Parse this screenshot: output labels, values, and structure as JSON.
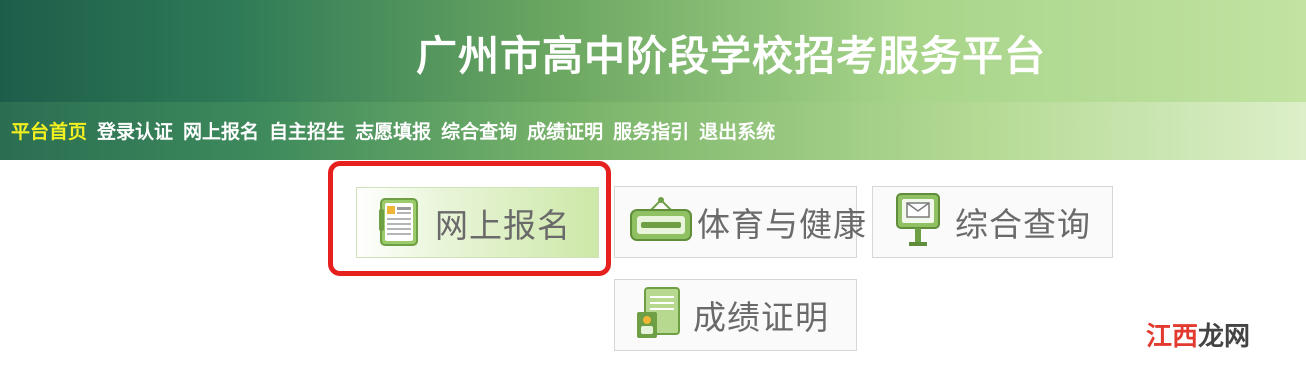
{
  "header": {
    "title": "广州市高中阶段学校招考服务平台"
  },
  "nav": {
    "items": [
      {
        "label": "平台首页",
        "active": true
      },
      {
        "label": "登录认证"
      },
      {
        "label": "网上报名"
      },
      {
        "label": "自主招生"
      },
      {
        "label": "志愿填报"
      },
      {
        "label": "综合查询"
      },
      {
        "label": "成绩证明"
      },
      {
        "label": "服务指引"
      },
      {
        "label": "退出系统"
      }
    ]
  },
  "tiles": {
    "registration": {
      "label": "网上报名",
      "icon": "document-form-icon"
    },
    "sports_health": {
      "label": "体育与健康",
      "icon": "sign-board-icon"
    },
    "query": {
      "label": "综合查询",
      "icon": "mail-sign-icon"
    },
    "grade_cert": {
      "label": "成绩证明",
      "icon": "certificate-icon"
    }
  },
  "watermark": {
    "part1": "江西",
    "part2": "龙网"
  },
  "colors": {
    "nav_active": "#f3f020",
    "highlight_border": "#e5201d",
    "tile_text": "#6a6a6a"
  }
}
